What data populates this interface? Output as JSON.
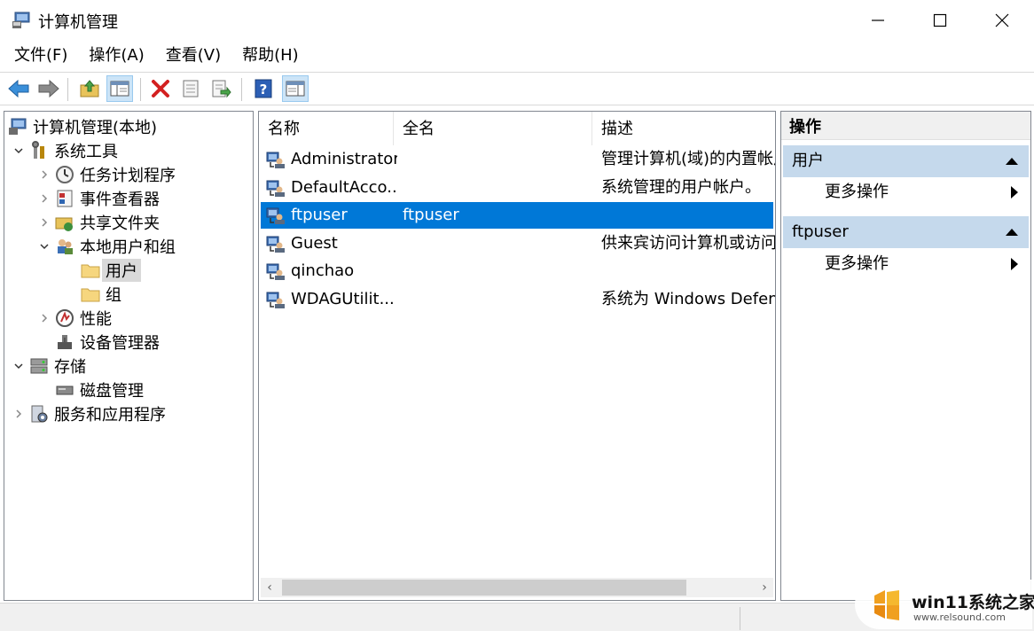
{
  "window": {
    "title": "计算机管理"
  },
  "menu": [
    "文件(F)",
    "操作(A)",
    "查看(V)",
    "帮助(H)"
  ],
  "toolbar": {
    "icons": [
      "back-arrow-icon",
      "forward-arrow-icon",
      "up-folder-icon",
      "show-hide-tree-icon",
      "delete-icon",
      "properties-icon",
      "export-list-icon",
      "help-icon",
      "show-hide-action-pane-icon"
    ]
  },
  "tree": {
    "items": [
      {
        "label": "计算机管理(本地)",
        "icon": "computer-management-icon",
        "expander": "none",
        "level": 0
      },
      {
        "label": "系统工具",
        "icon": "tools-icon",
        "expander": "expanded",
        "level": 1
      },
      {
        "label": "任务计划程序",
        "icon": "clock-icon",
        "expander": "collapsed",
        "level": 2
      },
      {
        "label": "事件查看器",
        "icon": "event-viewer-icon",
        "expander": "collapsed",
        "level": 2
      },
      {
        "label": "共享文件夹",
        "icon": "shared-folder-icon",
        "expander": "collapsed",
        "level": 2
      },
      {
        "label": "本地用户和组",
        "icon": "users-groups-icon",
        "expander": "expanded",
        "level": 2
      },
      {
        "label": "用户",
        "icon": "folder-icon",
        "expander": "none",
        "level": 3,
        "selected": true
      },
      {
        "label": "组",
        "icon": "folder-icon",
        "expander": "none",
        "level": 3
      },
      {
        "label": "性能",
        "icon": "performance-icon",
        "expander": "collapsed",
        "level": 2
      },
      {
        "label": "设备管理器",
        "icon": "device-manager-icon",
        "expander": "none",
        "level": 2
      },
      {
        "label": "存储",
        "icon": "storage-icon",
        "expander": "expanded",
        "level": 1
      },
      {
        "label": "磁盘管理",
        "icon": "disk-icon",
        "expander": "none",
        "level": 2
      },
      {
        "label": "服务和应用程序",
        "icon": "services-icon",
        "expander": "collapsed",
        "level": 1
      }
    ]
  },
  "list": {
    "columns": [
      "名称",
      "全名",
      "描述"
    ],
    "rows": [
      {
        "name": "Administrator",
        "full_name": "",
        "description": "管理计算机(域)的内置帐户",
        "selected": false
      },
      {
        "name": "DefaultAcco...",
        "full_name": "",
        "description": "系统管理的用户帐户。",
        "selected": false
      },
      {
        "name": "ftpuser",
        "full_name": "ftpuser",
        "description": "",
        "selected": true
      },
      {
        "name": "Guest",
        "full_name": "",
        "description": "供来宾访问计算机或访问域的内置帐户",
        "selected": false
      },
      {
        "name": "qinchao",
        "full_name": "",
        "description": "",
        "selected": false
      },
      {
        "name": "WDAGUtilit...",
        "full_name": "",
        "description": "系统为 Windows Defender 应用程序防护方案管理和使用的用户帐户。",
        "selected": false
      }
    ]
  },
  "actions": {
    "header": "操作",
    "groups": [
      {
        "title": "用户",
        "items": [
          "更多操作"
        ]
      },
      {
        "title": "ftpuser",
        "items": [
          "更多操作"
        ]
      }
    ]
  },
  "watermark": {
    "title": "win11系统之家",
    "url": "www.relsound.com"
  },
  "colors": {
    "selection": "#0078d7",
    "action_group": "#c5d9ec",
    "tree_selected": "#d9d9d9"
  }
}
